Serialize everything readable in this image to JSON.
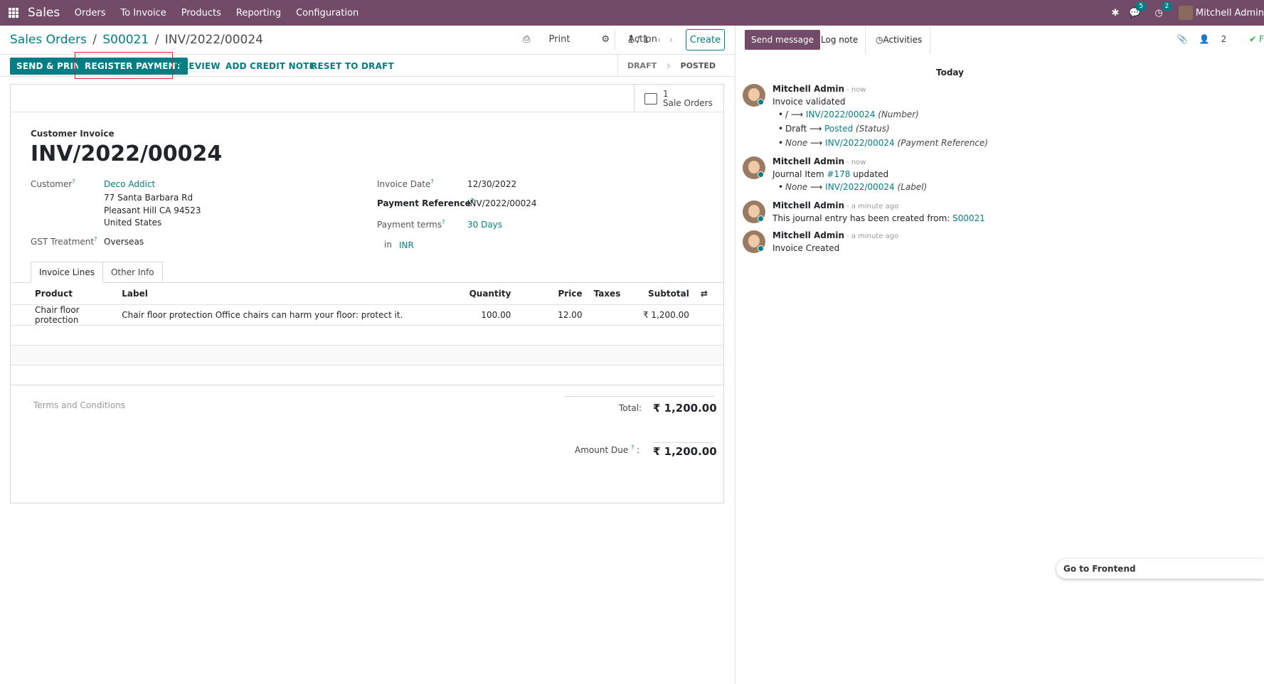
{
  "navbar": {
    "app_name": "Sales",
    "menu": [
      "Orders",
      "To Invoice",
      "Products",
      "Reporting",
      "Configuration"
    ],
    "messages_count": "5",
    "activities_count": "2",
    "user_name": "Mitchell Admin"
  },
  "breadcrumb": {
    "root": "Sales Orders",
    "order": "S00021",
    "current": "INV/2022/00024"
  },
  "control": {
    "print_label": "Print",
    "action_label": "Action",
    "pager": "1 / 1",
    "create_label": "Create"
  },
  "statusbar": {
    "buttons": [
      "SEND & PRINT",
      "REGISTER PAYMENT",
      "PREVIEW",
      "ADD CREDIT NOTE",
      "RESET TO DRAFT"
    ],
    "stages": [
      "DRAFT",
      "POSTED"
    ],
    "active_stage": "POSTED"
  },
  "smart_button": {
    "count": "1",
    "label": "Sale Orders"
  },
  "invoice": {
    "type_label": "Customer Invoice",
    "number": "INV/2022/00024",
    "customer_label": "Customer",
    "customer_name": "Deco Addict",
    "address_line1": "77 Santa Barbara Rd",
    "address_line2": "Pleasant Hill CA 94523",
    "address_line3": "United States",
    "gst_label": "GST Treatment",
    "gst_value": "Overseas",
    "date_label": "Invoice Date",
    "date_value": "12/30/2022",
    "payref_label": "Payment Reference",
    "payref_value": "INV/2022/00024",
    "terms_label": "Payment terms",
    "terms_value": "30 Days",
    "currency_prefix": "in",
    "currency": "INR"
  },
  "tabs": [
    "Invoice Lines",
    "Other Info"
  ],
  "lines": {
    "headers": [
      "Product",
      "Label",
      "Quantity",
      "Price",
      "Taxes",
      "Subtotal"
    ],
    "rows": [
      {
        "product": "Chair floor protection",
        "label": "Chair floor protection Office chairs can harm your floor: protect it.",
        "quantity": "100.00",
        "price": "12.00",
        "taxes": "",
        "subtotal": "₹ 1,200.00"
      }
    ]
  },
  "footer": {
    "terms_placeholder": "Terms and Conditions",
    "total_label": "Total:",
    "total_value": "₹ 1,200.00",
    "amount_due_label": "Amount Due",
    "amount_due_value": "₹ 1,200.00"
  },
  "chatter": {
    "send_message": "Send message",
    "log_note": "Log note",
    "activities": "Activities",
    "followers_count": "2",
    "date_separator": "Today",
    "messages": [
      {
        "author": "Mitchell Admin",
        "when": "- now",
        "body": "Invoice validated",
        "changes": [
          {
            "old": "/",
            "new": "INV/2022/00024",
            "field": "(Number)"
          },
          {
            "old": "Draft",
            "new": "Posted",
            "field": "(Status)"
          },
          {
            "old": "None",
            "new": "INV/2022/00024",
            "field": "(Payment Reference)"
          }
        ]
      },
      {
        "author": "Mitchell Admin",
        "when": "- now",
        "body_prefix": "Journal Item",
        "body_link": "#178",
        "body_suffix": "updated",
        "changes": [
          {
            "old": "None",
            "new": "INV/2022/00024",
            "field": "(Label)"
          }
        ]
      },
      {
        "author": "Mitchell Admin",
        "when": "- a minute ago",
        "body_prefix": "This journal entry has been created from:",
        "body_link": "S00021"
      },
      {
        "author": "Mitchell Admin",
        "when": "- a minute ago",
        "body": "Invoice Created"
      }
    ]
  },
  "go_frontend": "Go to Frontend"
}
